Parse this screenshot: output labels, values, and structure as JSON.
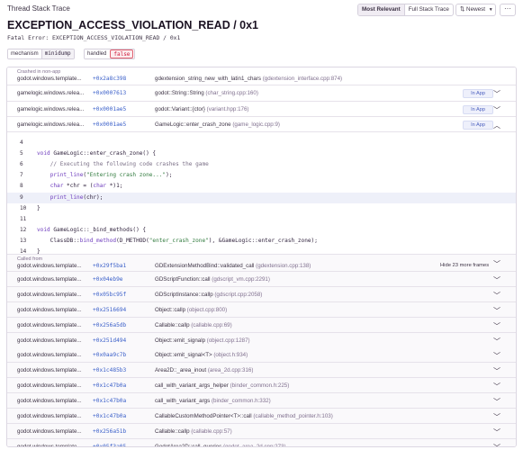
{
  "header": {
    "title": "Thread Stack Trace",
    "most_relevant": "Most Relevant",
    "full_stack_trace": "Full Stack Trace",
    "newest": "Newest",
    "more": "···"
  },
  "error": {
    "title": "EXCEPTION_ACCESS_VIOLATION_READ / 0x1",
    "subtitle": "Fatal Error: EXCEPTION_ACCESS_VIOLATION_READ / 0x1"
  },
  "tags": {
    "mechanism_key": "mechanism",
    "mechanism_value": "minidump",
    "handled_key": "handled",
    "handled_value": "false"
  },
  "frames_top": [
    {
      "note": "Crashed in non-app",
      "package": "godot.windows.template...",
      "address": "+0x2a8c398",
      "function": "gdextension_string_new_with_latin1_chars",
      "location": "(gdextension_interface.cpp:874)",
      "in_app": ""
    },
    {
      "note": "",
      "package": "gamelogic.windows.relea...",
      "address": "+0x0007613",
      "function": "godot::String::String",
      "location": "(char_string.cpp:160)",
      "in_app": "In App"
    },
    {
      "note": "",
      "package": "gamelogic.windows.relea...",
      "address": "+0x0001ae5",
      "function": "godot::Variant::{ctor}",
      "location": "(variant.hpp:176)",
      "in_app": "In App"
    },
    {
      "note": "",
      "package": "gamelogic.windows.relea...",
      "address": "+0x0001ae5",
      "function": "GameLogic::enter_crash_zone",
      "location": "(game_logic.cpp:9)",
      "in_app": "In App"
    }
  ],
  "code": [
    {
      "n": "4",
      "html": ""
    },
    {
      "n": "5",
      "html": "<span class=\"kw\">void</span> GameLogic::enter_crash_zone() {"
    },
    {
      "n": "6",
      "html": "    <span class=\"cm\">// Executing the following code crashes the game</span>"
    },
    {
      "n": "7",
      "html": "    <span class=\"kw\">print_line</span>(<span class=\"st\">\"Entering crash zone...\"</span>);"
    },
    {
      "n": "8",
      "html": "    <span class=\"kw\">char</span> *chr = (<span class=\"kw\">char</span> *)1;"
    },
    {
      "n": "9",
      "html": "    <span class=\"kw\">print_line</span>(chr);"
    },
    {
      "n": "10",
      "html": "}"
    },
    {
      "n": "11",
      "html": ""
    },
    {
      "n": "12",
      "html": "<span class=\"kw\">void</span> GameLogic::_bind_methods() {"
    },
    {
      "n": "13",
      "html": "    ClassDB::<span class=\"kw\">bind_method</span>(D_METHOD(<span class=\"st\">\"enter_crash_zone\"</span>), &amp;GameLogic::enter_crash_zone);"
    },
    {
      "n": "14",
      "html": "}"
    }
  ],
  "frames_bottom": [
    {
      "note": "Called from",
      "package": "godot.windows.template...",
      "address": "+0x29f5ba1",
      "function": "GDExtensionMethodBind::validated_call",
      "location": "(gdextension.cpp:138)",
      "hide": "Hide 23 more frames"
    },
    {
      "note": "",
      "package": "godot.windows.template...",
      "address": "+0x04eb9e",
      "function": "GDScriptFunction::call",
      "location": "(gdscript_vm.cpp:2291)",
      "hide": ""
    },
    {
      "note": "",
      "package": "godot.windows.template...",
      "address": "+0x05bc95f",
      "function": "GDScriptInstance::callp",
      "location": "(gdscript.cpp:2058)",
      "hide": ""
    },
    {
      "note": "",
      "package": "godot.windows.template...",
      "address": "+0x2516694",
      "function": "Object::callp",
      "location": "(object.cpp:800)",
      "hide": ""
    },
    {
      "note": "",
      "package": "godot.windows.template...",
      "address": "+0x256a5db",
      "function": "Callable::callp",
      "location": "(callable.cpp:69)",
      "hide": ""
    },
    {
      "note": "",
      "package": "godot.windows.template...",
      "address": "+0x251d494",
      "function": "Object::emit_signalp",
      "location": "(object.cpp:1287)",
      "hide": ""
    },
    {
      "note": "",
      "package": "godot.windows.template...",
      "address": "+0x0aa9c7b",
      "function": "Object::emit_signal<T>",
      "location": "(object.h:934)",
      "hide": ""
    },
    {
      "note": "",
      "package": "godot.windows.template...",
      "address": "+0x1c485b3",
      "function": "Area2D::_area_inout",
      "location": "(area_2d.cpp:316)",
      "hide": ""
    },
    {
      "note": "",
      "package": "godot.windows.template...",
      "address": "+0x1c47b0a",
      "function": "call_with_variant_args_helper",
      "location": "(binder_common.h:225)",
      "hide": ""
    },
    {
      "note": "",
      "package": "godot.windows.template...",
      "address": "+0x1c47b0a",
      "function": "call_with_variant_args",
      "location": "(binder_common.h:332)",
      "hide": ""
    },
    {
      "note": "",
      "package": "godot.windows.template...",
      "address": "+0x1c47b0a",
      "function": "CallableCustomMethodPointer<T>::call",
      "location": "(callable_method_pointer.h:103)",
      "hide": ""
    },
    {
      "note": "",
      "package": "godot.windows.template...",
      "address": "+0x256a51b",
      "function": "Callable::callp",
      "location": "(callable.cpp:57)",
      "hide": ""
    },
    {
      "note": "",
      "package": "godot.windows.template...",
      "address": "+0x05f3a05",
      "function": "GodotArea2D::call_queries",
      "location": "(godot_area_2d.cpp:273)",
      "hide": ""
    }
  ],
  "colors": {
    "address": "#3a5fc9",
    "in_app_badge": "#4b5fbf",
    "handled_false": "#d02040"
  }
}
